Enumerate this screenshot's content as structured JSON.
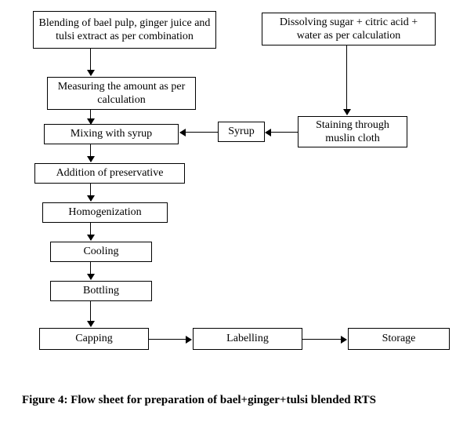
{
  "chart_data": {
    "type": "flowchart",
    "title": "Figure 4: Flow sheet for preparation of bael+ginger+tulsi blended RTS",
    "nodes": [
      {
        "id": "blending",
        "label": "Blending of bael pulp, ginger juice and tulsi extract as per combination"
      },
      {
        "id": "dissolving",
        "label": "Dissolving sugar + citric acid + water as per calculation"
      },
      {
        "id": "measuring",
        "label": "Measuring the amount as per calculation"
      },
      {
        "id": "straining",
        "label": "Staining through muslin cloth"
      },
      {
        "id": "syrup",
        "label": "Syrup"
      },
      {
        "id": "mixing",
        "label": "Mixing with syrup"
      },
      {
        "id": "preservative",
        "label": "Addition of preservative"
      },
      {
        "id": "homogenize",
        "label": "Homogenization"
      },
      {
        "id": "cooling",
        "label": "Cooling"
      },
      {
        "id": "bottling",
        "label": "Bottling"
      },
      {
        "id": "capping",
        "label": "Capping"
      },
      {
        "id": "labelling",
        "label": "Labelling"
      },
      {
        "id": "storage",
        "label": "Storage"
      }
    ],
    "edges": [
      [
        "blending",
        "measuring"
      ],
      [
        "measuring",
        "mixing"
      ],
      [
        "dissolving",
        "straining"
      ],
      [
        "straining",
        "syrup"
      ],
      [
        "syrup",
        "mixing"
      ],
      [
        "mixing",
        "preservative"
      ],
      [
        "preservative",
        "homogenize"
      ],
      [
        "homogenize",
        "cooling"
      ],
      [
        "cooling",
        "bottling"
      ],
      [
        "bottling",
        "capping"
      ],
      [
        "capping",
        "labelling"
      ],
      [
        "labelling",
        "storage"
      ]
    ]
  },
  "caption": "Figure 4: Flow sheet for preparation of bael+ginger+tulsi blended RTS"
}
